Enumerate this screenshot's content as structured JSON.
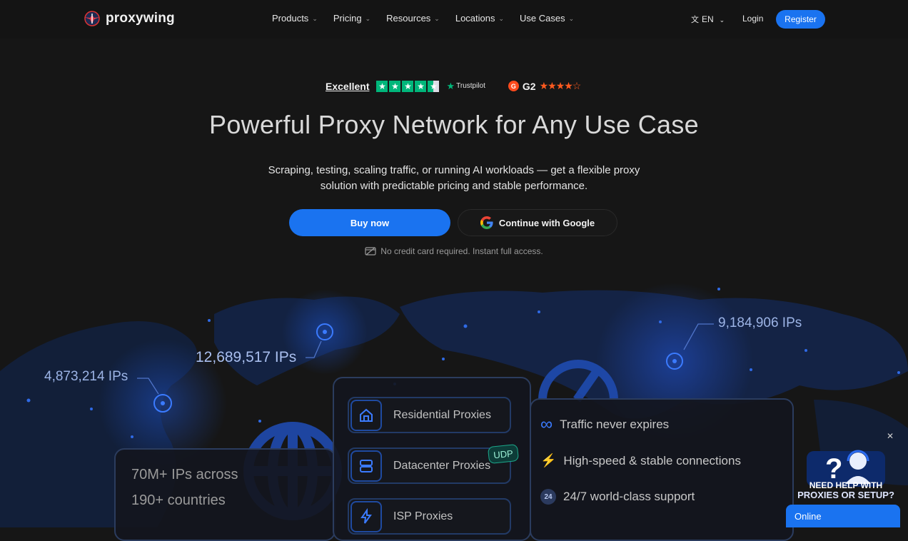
{
  "nav": {
    "brand": "proxywing",
    "items": [
      "Products",
      "Pricing",
      "Resources",
      "Locations",
      "Use Cases"
    ],
    "language": "EN",
    "login": "Login",
    "register": "Register"
  },
  "ratings": {
    "trustpilot_text": "Excellent",
    "trustpilot_label": "Trustpilot",
    "g2_text": "G2"
  },
  "hero": {
    "title": "Powerful Proxy Network for Any Use Case",
    "subtitle_line1": "Scraping, testing, scaling traffic, or running AI workloads — get a flexible proxy",
    "subtitle_line2": "solution with predictable pricing and stable performance.",
    "buy_label": "Buy now",
    "google_label": "Continue with Google",
    "note": "No credit card required. Instant full access."
  },
  "map": {
    "ip_left": "4,873,214 IPs",
    "ip_center": "12,689,517 IPs",
    "ip_right": "9,184,906 IPs"
  },
  "stats": {
    "line1": "70M+ IPs across",
    "line2": "190+ countries"
  },
  "products": [
    {
      "label": "Residential Proxies"
    },
    {
      "label": "Datacenter Proxies",
      "badge": "UDP"
    },
    {
      "label": "ISP Proxies"
    }
  ],
  "features": [
    {
      "icon": "infinity-icon",
      "label": "Traffic never expires"
    },
    {
      "icon": "lightning-icon",
      "label": "High-speed & stable connections"
    },
    {
      "icon": "24-icon",
      "label": "24/7 world-class support"
    }
  ],
  "help_widget": {
    "line1": "NEED HELP WITH",
    "line2": "PROXIES OR SETUP?",
    "status": "Online"
  },
  "colors": {
    "accent": "#1a73f0",
    "background": "#161616",
    "trustpilot": "#00b67a",
    "g2": "#ff4a1c"
  }
}
